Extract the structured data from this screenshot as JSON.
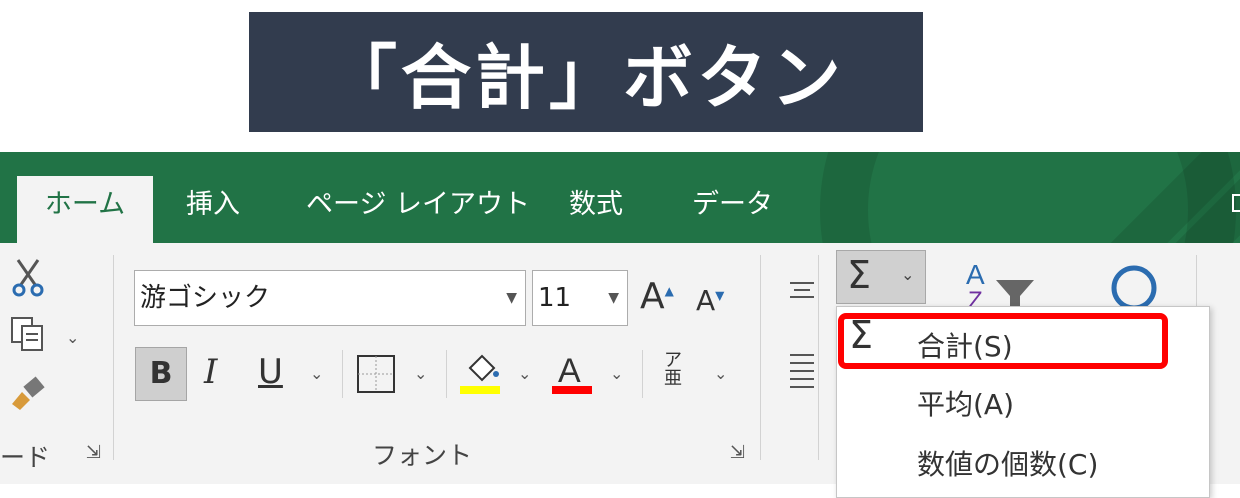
{
  "banner": {
    "title": "「合計」ボタン"
  },
  "tabs": [
    {
      "label": "ホーム",
      "active": true
    },
    {
      "label": "挿入"
    },
    {
      "label": "ページ レイアウト"
    },
    {
      "label": "数式"
    },
    {
      "label": "データ"
    }
  ],
  "font_group": {
    "font_name": "游ゴシック",
    "font_size": "11",
    "bold": "B",
    "italic": "I",
    "underline": "U",
    "label": "フォント"
  },
  "clipboard_group": {
    "label_partial": "ード"
  },
  "autosum_menu": {
    "items": [
      {
        "label": "合計(S)",
        "highlighted": true
      },
      {
        "label": "平均(A)"
      },
      {
        "label": "数値の個数(C)"
      }
    ]
  },
  "colors": {
    "ribbon_green": "#217346",
    "banner_bg": "#323c4e",
    "highlight_red": "#ff0000",
    "fill_yellow": "#ffff00",
    "font_red": "#ff0000"
  }
}
